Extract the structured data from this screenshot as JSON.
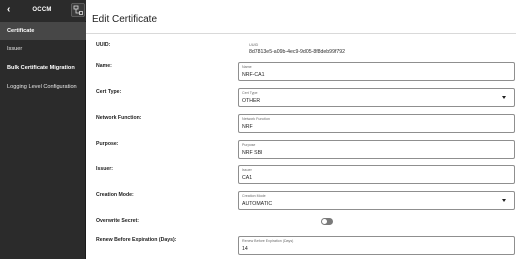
{
  "sidebar": {
    "title": "OCCM",
    "items": [
      {
        "label": "Certificate"
      },
      {
        "label": "Issuer"
      },
      {
        "label": "Bulk Certificate Migration"
      },
      {
        "label": "Logging Level Configuration"
      }
    ]
  },
  "page": {
    "title": "Edit Certificate"
  },
  "form": {
    "uuid": {
      "label": "UUID:",
      "caption": "UUID",
      "value": "8d7813e5-a09b-4ec9-9d05-8f8deb99f792"
    },
    "name": {
      "label": "Name:",
      "caption": "Name",
      "value": "NRF-CA1"
    },
    "cert_type": {
      "label": "Cert Type:",
      "caption": "Cert Type",
      "value": "OTHER"
    },
    "network_function": {
      "label": "Network Function:",
      "caption": "Network Function",
      "value": "NRF"
    },
    "purpose": {
      "label": "Purpose:",
      "caption": "Purpose",
      "value": "NRF SBI"
    },
    "issuer": {
      "label": "Issuer:",
      "caption": "Issuer",
      "value": "CA1"
    },
    "creation_mode": {
      "label": "Creation Mode:",
      "caption": "Creation Mode",
      "value": "AUTOMATIC"
    },
    "overwrite_secret": {
      "label": "Overwrite Secret:",
      "value": false
    },
    "renew_before": {
      "label": "Renew Before Expiration (Days):",
      "caption": "Renew Before Expiration (Days)",
      "value": "14"
    }
  }
}
